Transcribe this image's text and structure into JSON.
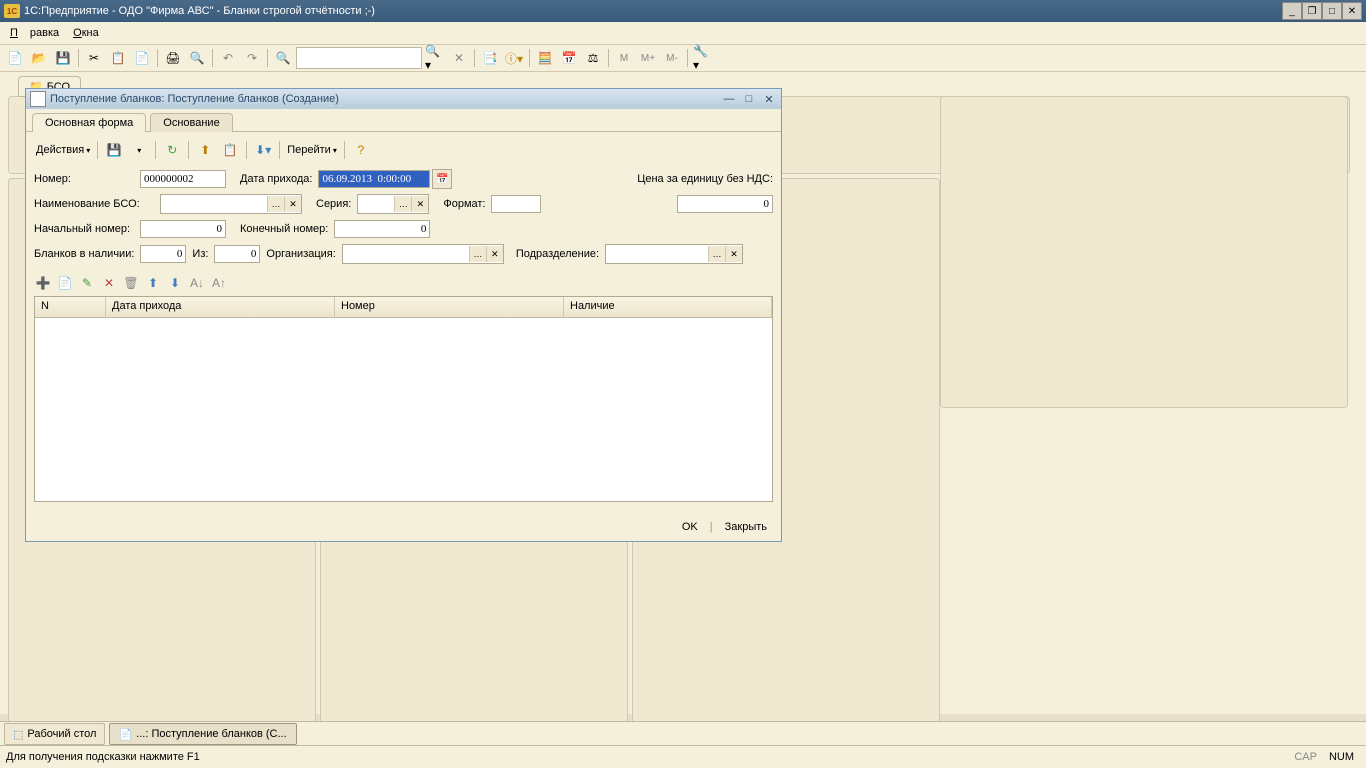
{
  "app": {
    "title": "1С:Предприятие - ОДО \"Фирма АВС\" - Бланки строгой отчётности ;-)",
    "logo_text": "1C"
  },
  "menu": {
    "edit": "Правка",
    "windows": "Окна"
  },
  "toolbar_letters": {
    "m": "M",
    "mplus": "M+",
    "mminus": "M-"
  },
  "bg_tab": {
    "label": "БСО"
  },
  "dialog": {
    "title": "Поступление бланков: Поступление бланков (Создание)",
    "tabs": {
      "main": "Основная форма",
      "basis": "Основание"
    },
    "actions_label": "Действия",
    "goto_label": "Перейти",
    "fields": {
      "number_label": "Номер:",
      "number_value": "000000002",
      "date_label": "Дата прихода:",
      "date_value": "06.09.2013  0:00:00",
      "price_label": "Цена за единицу без НДС:",
      "price_value": "0",
      "bso_name_label": "Наименование БСО:",
      "series_label": "Серия:",
      "format_label": "Формат:",
      "start_num_label": "Начальный номер:",
      "start_num_value": "0",
      "end_num_label": "Конечный номер:",
      "end_num_value": "0",
      "in_stock_label": "Бланков в наличии:",
      "in_stock_value": "0",
      "from_label": "Из:",
      "from_value": "0",
      "org_label": "Организация:",
      "dept_label": "Подразделение:"
    },
    "grid": {
      "col_n": "N",
      "col_date": "Дата прихода",
      "col_num": "Номер",
      "col_stock": "Наличие"
    },
    "footer": {
      "ok": "OK",
      "close": "Закрыть"
    }
  },
  "taskbar": {
    "desktop": "Рабочий стол",
    "doc": "...: Поступление бланков (С..."
  },
  "status": {
    "hint": "Для получения подсказки нажмите F1",
    "cap": "CAP",
    "num": "NUM"
  }
}
